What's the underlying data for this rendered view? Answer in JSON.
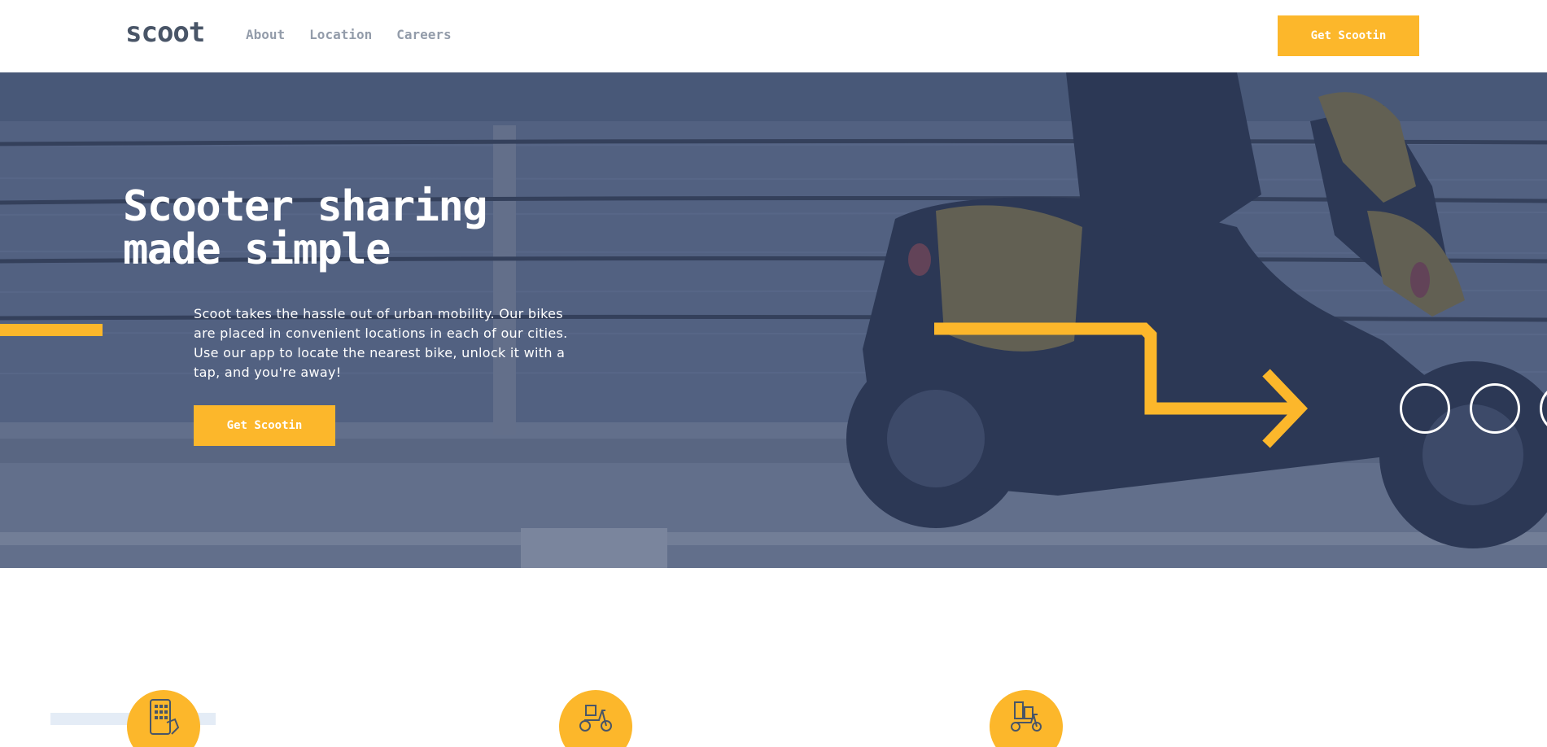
{
  "header": {
    "logo": "scoot",
    "nav": [
      {
        "label": "About"
      },
      {
        "label": "Location"
      },
      {
        "label": "Careers"
      }
    ],
    "cta_label": "Get Scootin"
  },
  "hero": {
    "title_line1": "Scooter sharing",
    "title_line2": "made simple",
    "body": "Scoot takes the hassle out of urban mobility. Our bikes are placed in convenient locations in each of our cities. Use our app to locate the nearest bike, unlock it with a tap, and you're away!",
    "cta_label": "Get Scootin",
    "background_image": "scooter-rider-photo"
  },
  "features": {
    "icons": [
      {
        "name": "phone-app-icon"
      },
      {
        "name": "scooter-icon"
      },
      {
        "name": "city-scooter-icon"
      }
    ]
  },
  "colors": {
    "accent": "#fcb72b",
    "dark_text": "#495567",
    "nav_text": "#939caa",
    "hero_overlay": "#2c3a5c",
    "strip": "#e4ecf6"
  }
}
